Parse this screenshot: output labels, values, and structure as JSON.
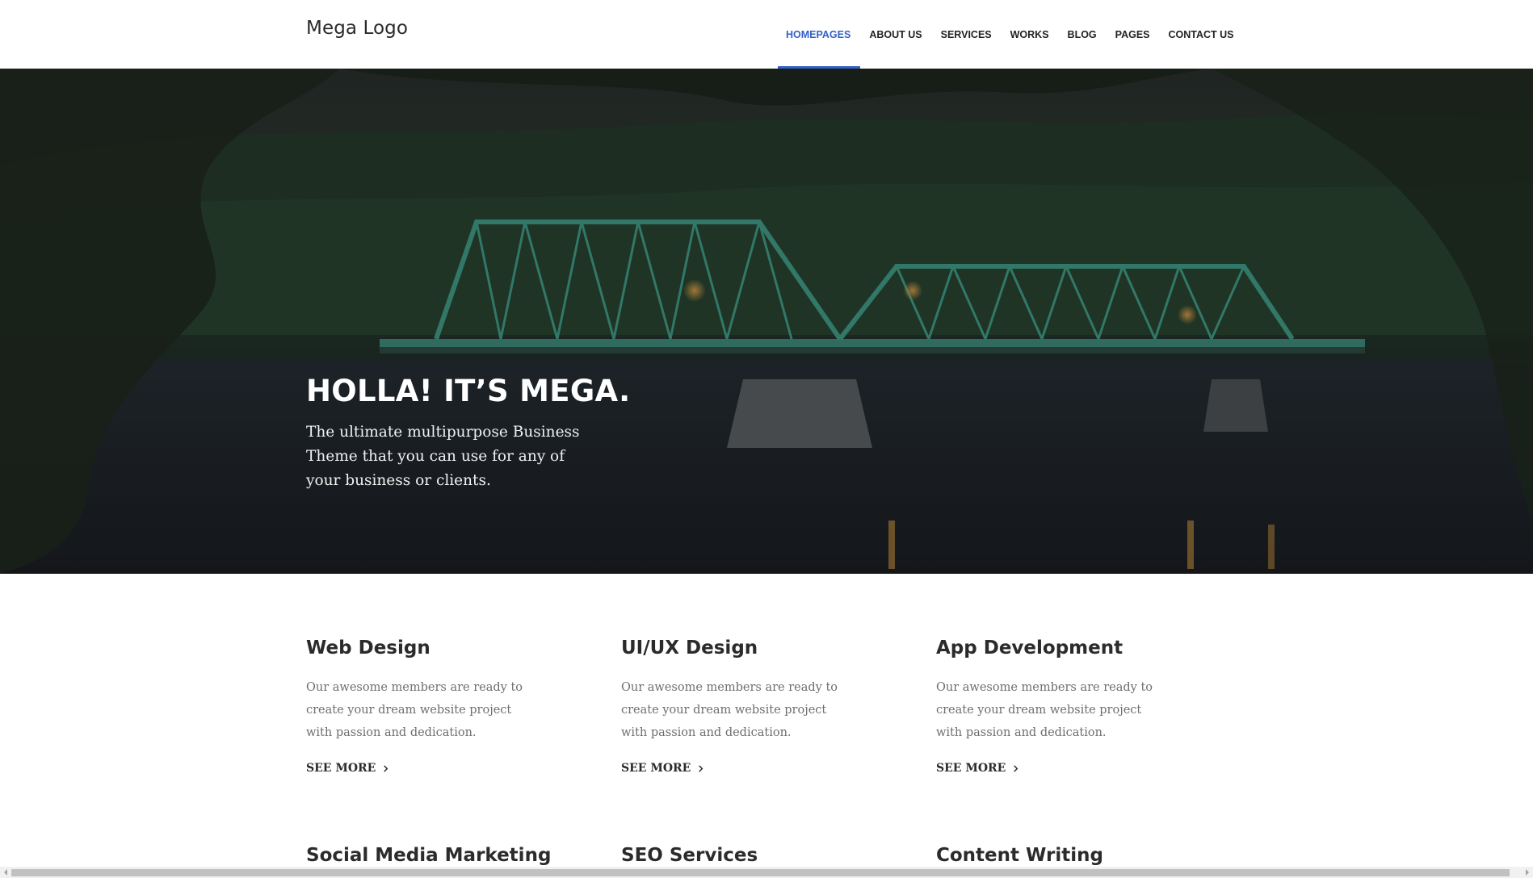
{
  "header": {
    "logo": "Mega Logo",
    "nav": [
      {
        "label": "HOMEPAGES",
        "active": true
      },
      {
        "label": "ABOUT US",
        "active": false
      },
      {
        "label": "SERVICES",
        "active": false
      },
      {
        "label": "WORKS",
        "active": false
      },
      {
        "label": "BLOG",
        "active": false
      },
      {
        "label": "PAGES",
        "active": false
      },
      {
        "label": "CONTACT US",
        "active": false
      }
    ]
  },
  "hero": {
    "title": "HOLLA! IT’S MEGA.",
    "text": "The ultimate multipurpose Business Theme that you can use for any of your business or clients."
  },
  "services": [
    {
      "title": "Web Design",
      "text": "Our awesome members are ready to create your dream website project with passion and dedication.",
      "link": "SEE MORE"
    },
    {
      "title": "UI/UX Design",
      "text": "Our awesome members are ready to create your dream website project with passion and dedication.",
      "link": "SEE MORE"
    },
    {
      "title": "App Development",
      "text": "Our awesome members are ready to create your dream website project with passion and dedication.",
      "link": "SEE MORE"
    },
    {
      "title": "Social Media Marketing",
      "text": "",
      "link": ""
    },
    {
      "title": "SEO Services",
      "text": "",
      "link": ""
    },
    {
      "title": "Content Writing",
      "text": "",
      "link": ""
    }
  ],
  "colors": {
    "accent": "#3460c6",
    "heading": "#2b2b2b",
    "body_text": "#6e6e6e"
  },
  "icons": {
    "see_more": "chevron-right-icon",
    "scroll_left": "arrow-left-icon",
    "scroll_right": "arrow-right-icon"
  }
}
